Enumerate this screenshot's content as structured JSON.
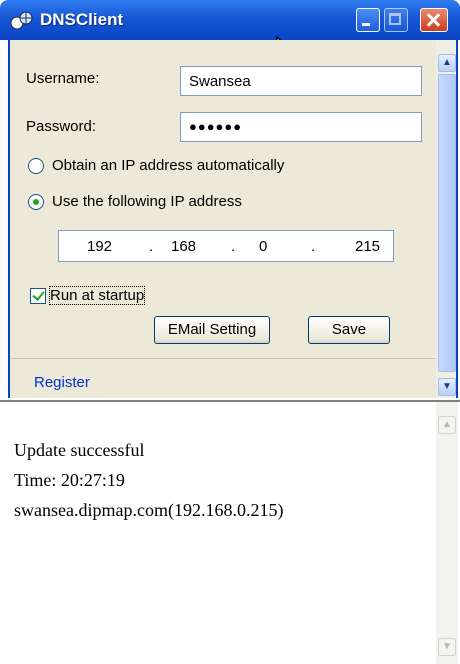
{
  "window": {
    "title": "DNSClient"
  },
  "form": {
    "username_label": "Username:",
    "username_value": "Swansea",
    "password_label": "Password:",
    "password_value": "●●●●●●",
    "radio_auto_label": "Obtain an IP address automatically",
    "radio_manual_label": "Use the following IP address",
    "ip": [
      "192",
      "168",
      "0",
      "215"
    ],
    "ip_dot": ".",
    "run_at_startup_label": "Run at startup",
    "email_button": "EMail Setting",
    "save_button": "Save",
    "register_link": "Register"
  },
  "output": {
    "lines": [
      "Update successful",
      "Time: 20:27:19",
      "swansea.dipmap.com(192.168.0.215)"
    ]
  },
  "icons": {
    "app": "network-globe-icon",
    "cursor": "mouse-pointer-icon"
  },
  "colors": {
    "titlebar": "#0a44c3",
    "panel": "#ece9d8",
    "link": "#0033cc",
    "accent_check": "#21a121"
  }
}
